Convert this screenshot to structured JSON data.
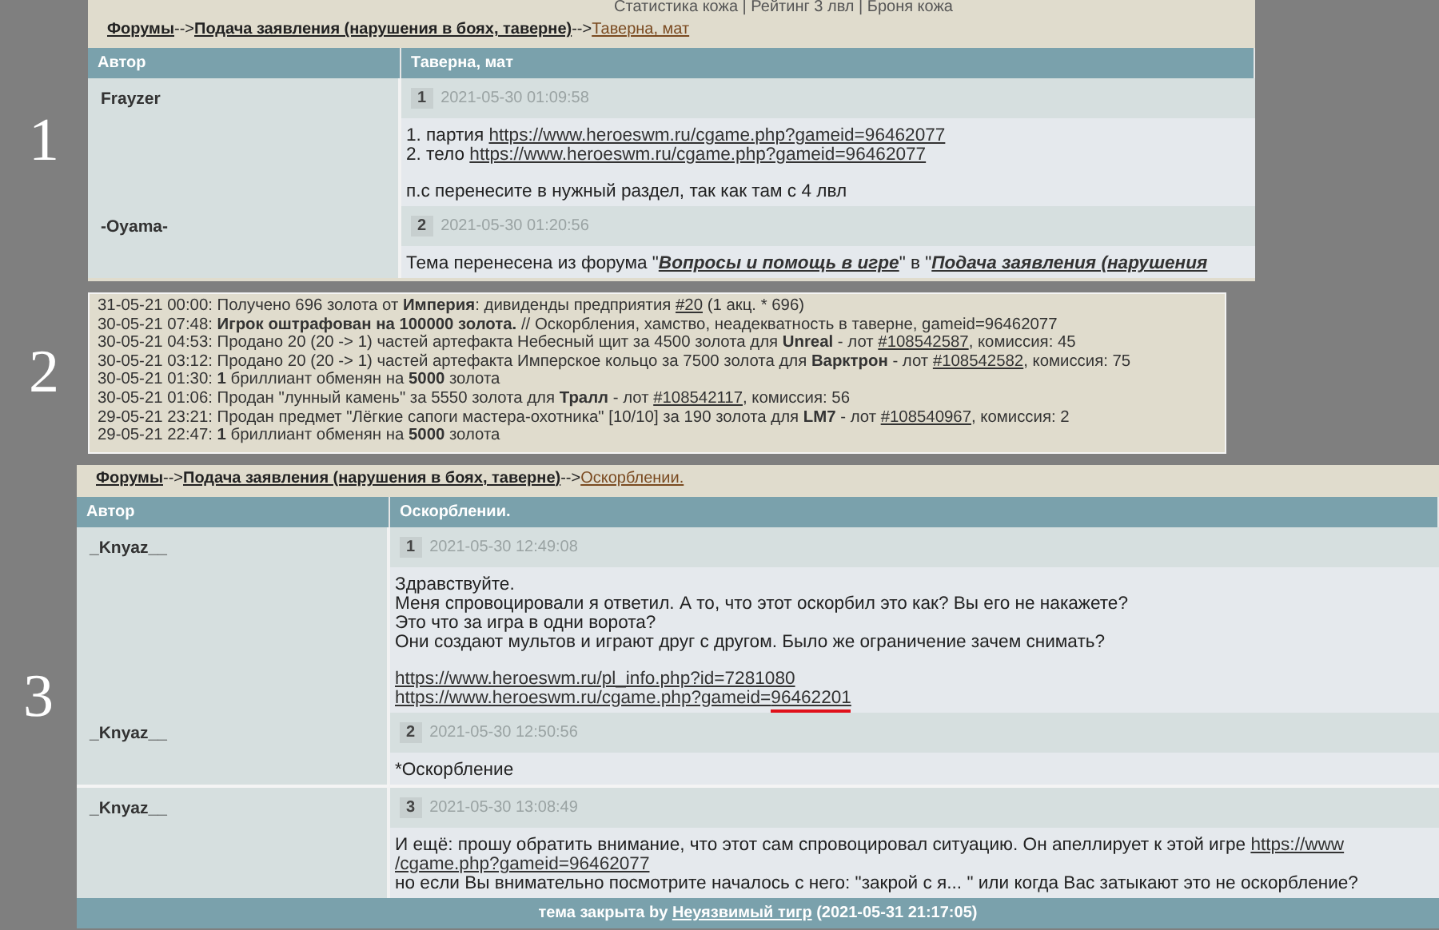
{
  "panels": [
    {
      "label": "1",
      "kind": "forum",
      "top_note": "Статистика кожа | Рейтинг 3 лвл | Броня кожа",
      "breadcrumb": [
        {
          "text": "Форумы",
          "kind": "bold-link"
        },
        {
          "text": "-->",
          "kind": "separator"
        },
        {
          "text": "Подача заявления (нарушения в боях, таверне)",
          "kind": "bold-link"
        },
        {
          "text": "-->",
          "kind": "separator"
        },
        {
          "text": "Таверна, мат",
          "kind": "link"
        }
      ],
      "columns": [
        "Автор",
        "Таверна, мат"
      ],
      "posts": [
        {
          "author": "Frayzer",
          "number": "1",
          "time": "2021-05-30 01:09:58",
          "paragraphs": [
            [
              [
                {
                  "text": "1. партия ",
                  "kind": "text"
                },
                {
                  "text": "https://www.heroeswm.ru/cgame.php?gameid=96462077",
                  "kind": "link"
                }
              ],
              [
                {
                  "text": "2. тело ",
                  "kind": "text"
                },
                {
                  "text": "https://www.heroeswm.ru/cgame.php?gameid=96462077",
                  "kind": "link"
                }
              ]
            ],
            [
              [
                {
                  "text": "п.с перенесите в нужный раздел, так как там с 4 лвл",
                  "kind": "text"
                }
              ]
            ]
          ]
        },
        {
          "author": "-Oyama-",
          "number": "2",
          "time": "2021-05-30 01:20:56",
          "paragraphs": [
            [
              [
                {
                  "text": "Тема перенесена из форума \"",
                  "kind": "text"
                },
                {
                  "text": "Вопросы и помощь в игре",
                  "kind": "italic-link"
                },
                {
                  "text": "\" в \"",
                  "kind": "text"
                },
                {
                  "text": "Подача заявления (нарушения",
                  "kind": "italic-link"
                }
              ]
            ]
          ]
        }
      ]
    },
    {
      "label": "2",
      "kind": "log",
      "lines": [
        [
          {
            "text": "31-05-21 00:00: Получено 696 золота от **Империя**: дивиденды предприятия ",
            "kind": "text"
          },
          {
            "text": "#20",
            "kind": "link"
          },
          {
            "text": " (1 акц. * 696)",
            "kind": "text"
          }
        ],
        [
          {
            "text": "30-05-21 07:48: **Игрок оштрафован на 100000 золота.** // Оскорбления, хамство, неадекватность в таверне, gameid=96462077",
            "kind": "text"
          }
        ],
        [
          {
            "text": "30-05-21 04:53: Продано 20 (20 -> 1) частей артефакта Небесный щит за 4500 золота для **Unreal** - лот ",
            "kind": "text"
          },
          {
            "text": "#108542587",
            "kind": "link"
          },
          {
            "text": ", комиссия: 45",
            "kind": "text"
          }
        ],
        [
          {
            "text": "30-05-21 03:12: Продано 20 (20 -> 1) частей артефакта Имперское кольцо за 7500 золота для **Варктрон** - лот ",
            "kind": "text"
          },
          {
            "text": "#108542582",
            "kind": "link"
          },
          {
            "text": ", комиссия: 75",
            "kind": "text"
          }
        ],
        [
          {
            "text": "30-05-21 01:30: **1** бриллиант обменян на **5000** золота",
            "kind": "text"
          }
        ],
        [
          {
            "text": "30-05-21 01:06: Продан \"лунный камень\" за 5550 золота для **Тралл** - лот ",
            "kind": "text"
          },
          {
            "text": "#108542117",
            "kind": "link"
          },
          {
            "text": ", комиссия: 56",
            "kind": "text"
          }
        ],
        [
          {
            "text": "29-05-21 23:21: Продан предмет \"Лёгкие сапоги мастера-охотника\" [10/10] за 190 золота для **LM7** - лот ",
            "kind": "text"
          },
          {
            "text": "#108540967",
            "kind": "link"
          },
          {
            "text": ", комиссия: 2",
            "kind": "text"
          }
        ],
        [
          {
            "text": "29-05-21 22:47: **1** бриллиант обменян на **5000** золота",
            "kind": "text"
          }
        ]
      ]
    },
    {
      "label": "3",
      "kind": "forum",
      "breadcrumb": [
        {
          "text": "Форумы",
          "kind": "bold-link"
        },
        {
          "text": "-->",
          "kind": "separator"
        },
        {
          "text": "Подача заявления (нарушения в боях, таверне)",
          "kind": "bold-link"
        },
        {
          "text": "-->",
          "kind": "separator"
        },
        {
          "text": "Оскорблении.",
          "kind": "link"
        }
      ],
      "columns": [
        "Автор",
        "Оскорблении."
      ],
      "posts": [
        {
          "author": "_Knyaz__",
          "number": "1",
          "time": "2021-05-30 12:49:08",
          "paragraphs": [
            [
              [
                {
                  "text": "Здравствуйте.",
                  "kind": "text"
                }
              ],
              [
                {
                  "text": "Меня спровоцировали я ответил. А то, что этот оскорбил это как? Вы его не накажете?",
                  "kind": "text"
                }
              ],
              [
                {
                  "text": "Это что за игра в одни ворота?",
                  "kind": "text"
                }
              ],
              [
                {
                  "text": "Они создают мультов и играют друг с другом. Было же ограничение зачем снимать?",
                  "kind": "text"
                }
              ]
            ],
            [
              [
                {
                  "text": "https://www.heroeswm.ru/pl_info.php?id=7281080",
                  "kind": "link"
                }
              ],
              [
                {
                  "text": "https://www.heroeswm.ru/cgame.php?gameid=",
                  "kind": "link"
                },
                {
                  "text": "96462201",
                  "kind": "marked-link"
                }
              ]
            ]
          ]
        },
        {
          "author": "_Knyaz__",
          "number": "2",
          "time": "2021-05-30 12:50:56",
          "paragraphs": [
            [
              [
                {
                  "text": "*Оскорбление",
                  "kind": "text"
                }
              ]
            ]
          ]
        },
        {
          "author": "_Knyaz__",
          "number": "3",
          "time": "2021-05-30 13:08:49",
          "paragraphs": [
            [
              [
                {
                  "text": "И ещё: прошу обратить внимание, что этот сам спровоцировал ситуацию. Он апеллирует к этой игре ",
                  "kind": "text"
                },
                {
                  "text": "https://www",
                  "kind": "link"
                }
              ],
              [
                {
                  "text": "/cgame.php?gameid=96462077",
                  "kind": "link"
                }
              ],
              [
                {
                  "text": "но если Вы внимательно посмотрите началось с него: \"закрой с я... \" или когда Вас затыкают это не оскорбление?",
                  "kind": "text"
                }
              ]
            ]
          ]
        }
      ],
      "footer": [
        {
          "text": "тема закрыта by ",
          "kind": "text"
        },
        {
          "text": "Неуязвимый тигр",
          "kind": "link"
        },
        {
          "text": " (2021-05-31 21:17:05)",
          "kind": "text"
        }
      ]
    }
  ]
}
